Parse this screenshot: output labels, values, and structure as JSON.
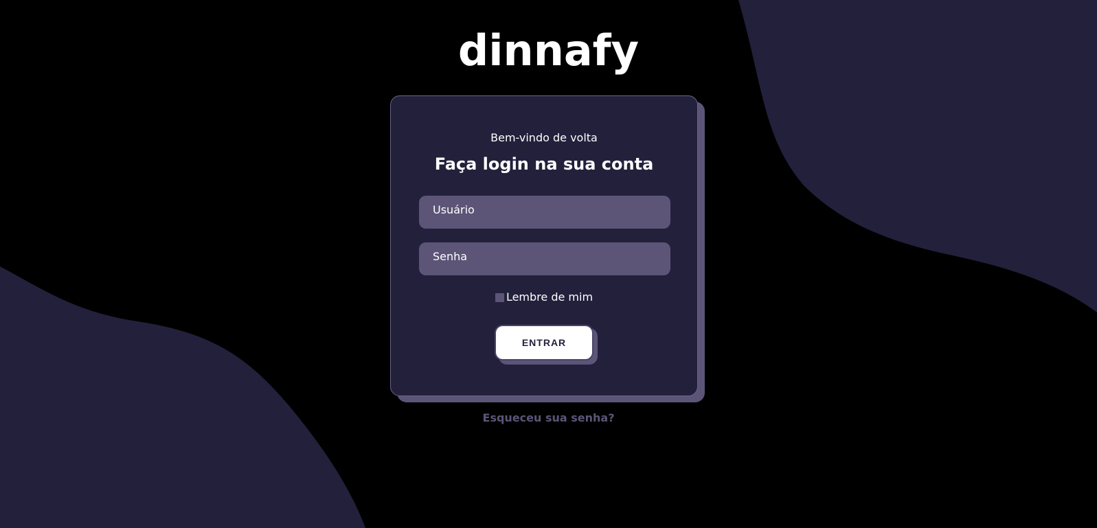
{
  "brand": {
    "logo_text": "dinnafy"
  },
  "login_card": {
    "welcome_text": "Bem-vindo de volta",
    "heading": "Faça login na sua conta",
    "username_placeholder": "Usuário",
    "password_placeholder": "Senha",
    "remember_label": "Lembre de mim",
    "remember_checked": false,
    "submit_label": "ENTRAR"
  },
  "forgot_password_link": "Esqueceu sua senha?",
  "colors": {
    "background": "#000000",
    "wave": "#23203c",
    "card": "#23203c",
    "input": "#5c5577",
    "accent_muted": "#5c5577",
    "button": "#ffffff",
    "text": "#ffffff"
  },
  "icons": {
    "remember_checkbox": "checkbox-unchecked-icon"
  }
}
